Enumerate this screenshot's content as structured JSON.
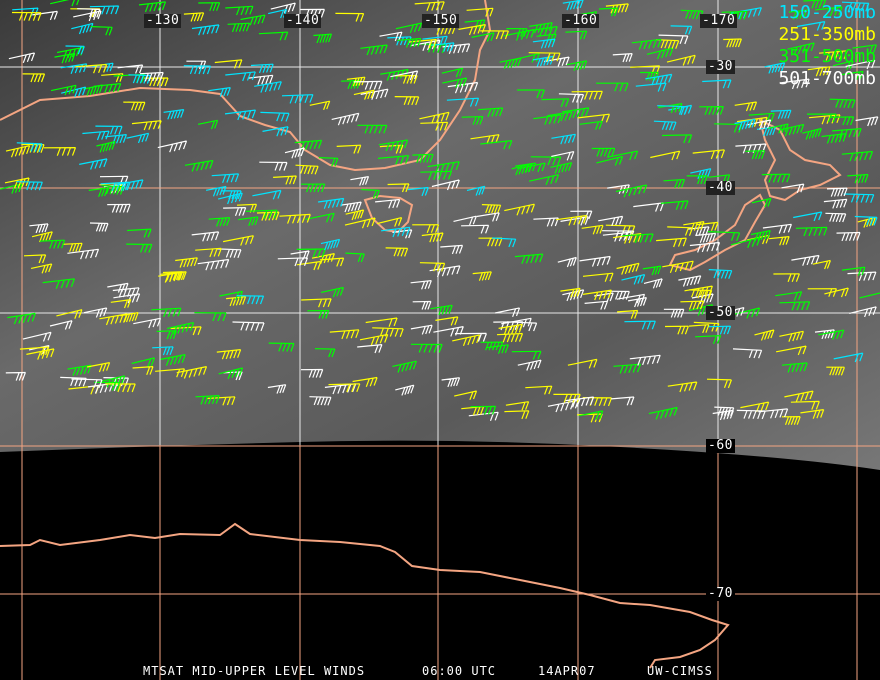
{
  "title": "MTSAT MID-UPPER LEVEL WINDS",
  "time": "06:00 UTC",
  "date": "14APR07",
  "source": "UW-CIMSS",
  "legend": [
    {
      "label": "150-250mb",
      "color": "#00e5ff"
    },
    {
      "label": "251-350mb",
      "color": "#ffff00"
    },
    {
      "label": "351-500mb",
      "color": "#00ff00"
    },
    {
      "label": "501-700mb",
      "color": "#ffffff"
    }
  ],
  "longitude_labels": [
    "-130",
    "-140",
    "-150",
    "-160",
    "-170"
  ],
  "latitude_labels": [
    "-30",
    "-40",
    "-50",
    "-60",
    "-70"
  ],
  "colors": {
    "coastline": "#f4a582",
    "grid_orange": "#f4a582",
    "grid_white": "#e8e8e8"
  }
}
